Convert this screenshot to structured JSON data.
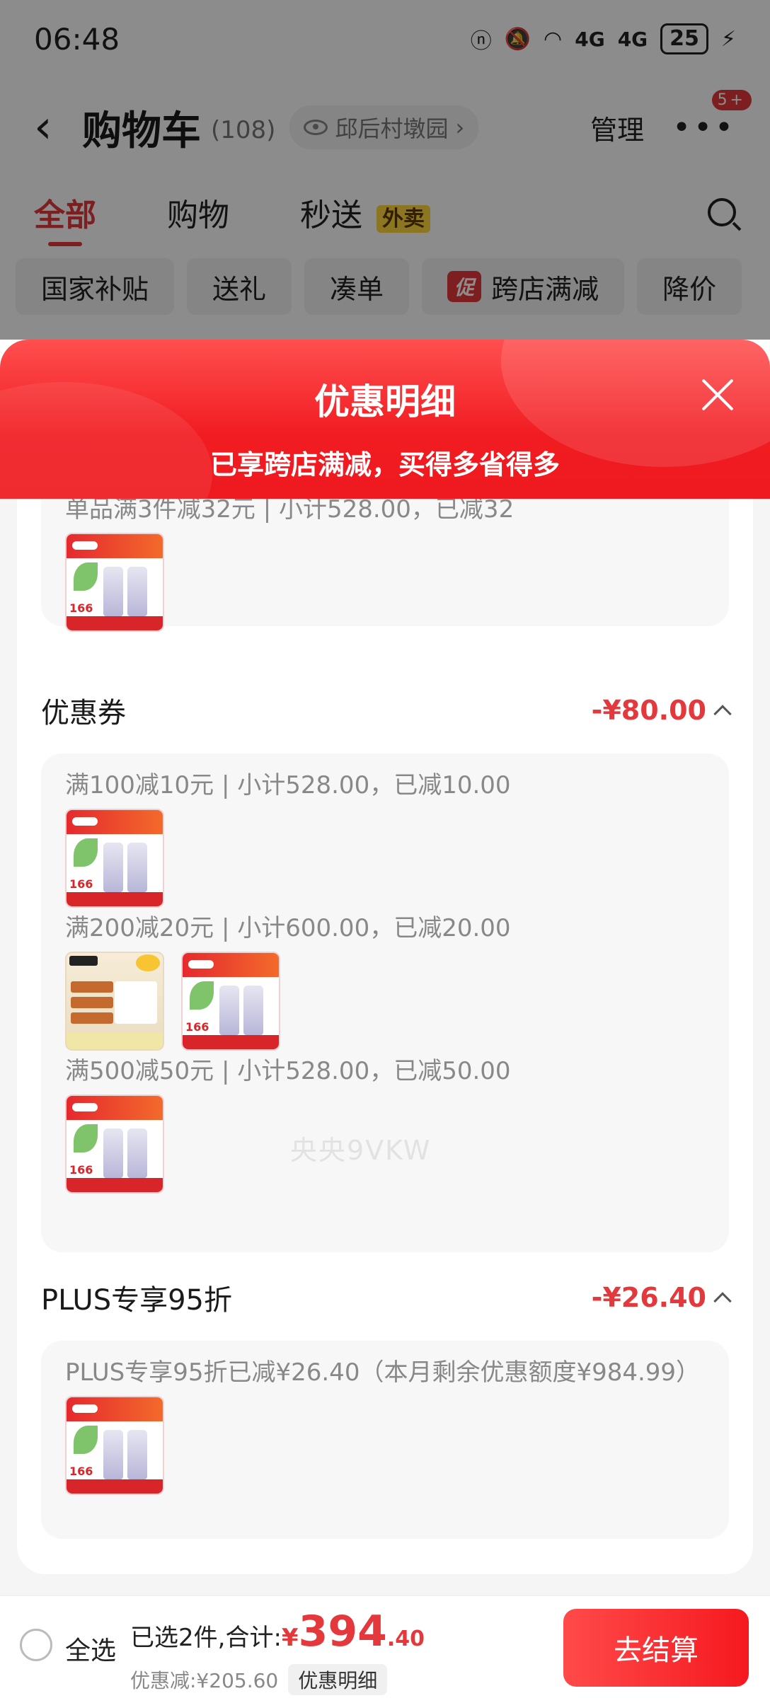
{
  "status_bar": {
    "time": "06:48",
    "network": "4G",
    "network2": "4G",
    "battery": "25"
  },
  "header": {
    "title": "购物车",
    "count": "(108)",
    "address": "邱后村墩园",
    "manage": "管理",
    "badge": "5+"
  },
  "tabs": [
    {
      "label": "全部"
    },
    {
      "label": "购物"
    },
    {
      "label": "秒送",
      "badge": "外卖"
    }
  ],
  "filters": [
    {
      "label": "国家补贴"
    },
    {
      "label": "送礼"
    },
    {
      "label": "凑单"
    },
    {
      "label": "跨店满减",
      "tag": "促"
    },
    {
      "label": "降价"
    }
  ],
  "sheet": {
    "title": "优惠明细",
    "subtitle": "已享跨店满减，买得多省得多",
    "cross_store_rule": "单品满3件减32元 | 小计528.00，已减32",
    "coupon_section": {
      "label": "优惠券",
      "amount": "-¥80.00",
      "rules": [
        "满100减10元 | 小计528.00，已减10.00",
        "满200减20元 | 小计600.00，已减20.00",
        "满500减50元 | 小计528.00，已减50.00"
      ]
    },
    "plus_section": {
      "label": "PLUS专享95折",
      "amount": "-¥26.40",
      "rule": "PLUS专享95折已减¥26.40（本月剩余优惠额度¥984.99）"
    },
    "thumb_price": "166",
    "watermark": "央央9VKW"
  },
  "bottom_bar": {
    "select_all": "全选",
    "summary": "已选2件,合计:",
    "currency": "¥",
    "price_int": "394",
    "price_dec": ".40",
    "discount": "优惠减:¥205.60",
    "detail_button": "优惠明细",
    "checkout": "去结算"
  }
}
